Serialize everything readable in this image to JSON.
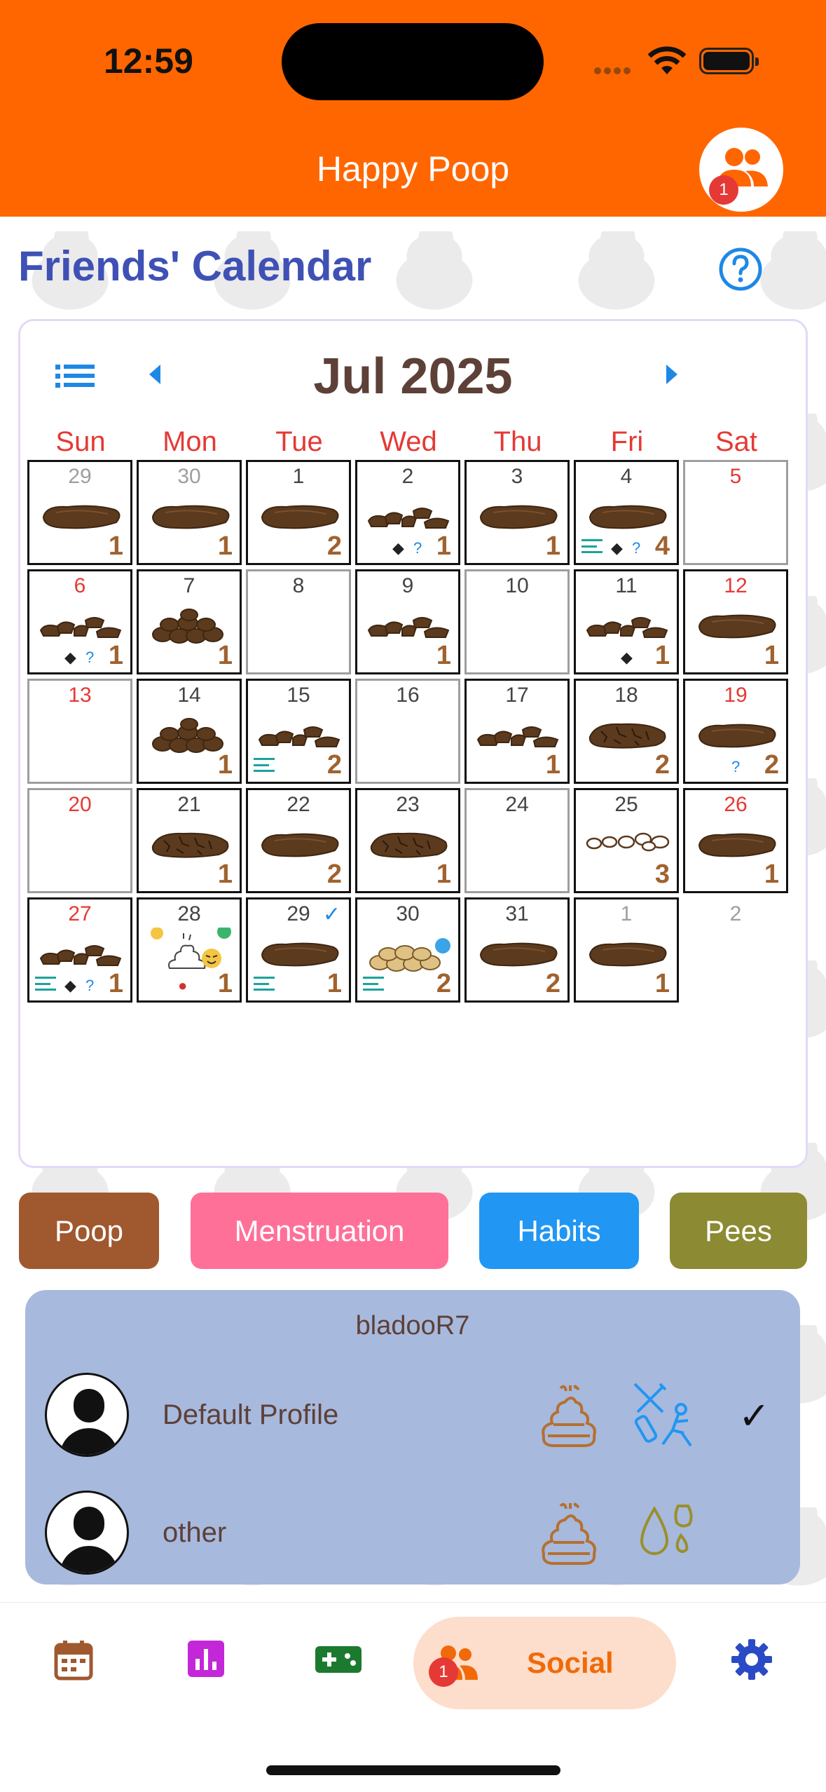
{
  "status_bar": {
    "time": "12:59"
  },
  "app": {
    "title": "Happy Poop",
    "friend_badge": "1"
  },
  "page": {
    "title": "Friends' Calendar"
  },
  "calendar": {
    "month_label": "Jul 2025",
    "weekdays": [
      "Sun",
      "Mon",
      "Tue",
      "Wed",
      "Thu",
      "Fri",
      "Sat"
    ],
    "weeks": [
      [
        {
          "d": "29",
          "c": "1",
          "p": "log",
          "other": true
        },
        {
          "d": "30",
          "c": "1",
          "p": "log",
          "other": true
        },
        {
          "d": "1",
          "c": "2",
          "p": "log"
        },
        {
          "d": "2",
          "c": "1",
          "p": "lumps",
          "skunk": true,
          "q": true
        },
        {
          "d": "3",
          "c": "1",
          "p": "log"
        },
        {
          "d": "4",
          "c": "4",
          "p": "log",
          "notes": true,
          "skunk": true,
          "q": true
        },
        {
          "d": "5",
          "c": "",
          "p": "",
          "weekend": true
        }
      ],
      [
        {
          "d": "6",
          "c": "1",
          "p": "lumps",
          "weekend": true,
          "skunk": true,
          "q": true
        },
        {
          "d": "7",
          "c": "1",
          "p": "pile"
        },
        {
          "d": "8",
          "c": "",
          "p": ""
        },
        {
          "d": "9",
          "c": "1",
          "p": "lumps"
        },
        {
          "d": "10",
          "c": "",
          "p": ""
        },
        {
          "d": "11",
          "c": "1",
          "p": "lumps",
          "skunk": true
        },
        {
          "d": "12",
          "c": "1",
          "p": "log",
          "weekend": true
        }
      ],
      [
        {
          "d": "13",
          "c": "",
          "p": "",
          "weekend": true
        },
        {
          "d": "14",
          "c": "1",
          "p": "pile"
        },
        {
          "d": "15",
          "c": "2",
          "p": "lumps",
          "notes": true
        },
        {
          "d": "16",
          "c": "",
          "p": ""
        },
        {
          "d": "17",
          "c": "1",
          "p": "lumps"
        },
        {
          "d": "18",
          "c": "2",
          "p": "cracked"
        },
        {
          "d": "19",
          "c": "2",
          "p": "log",
          "weekend": true,
          "q": true
        }
      ],
      [
        {
          "d": "20",
          "c": "",
          "p": "",
          "weekend": true
        },
        {
          "d": "21",
          "c": "1",
          "p": "cracked"
        },
        {
          "d": "22",
          "c": "2",
          "p": "log"
        },
        {
          "d": "23",
          "c": "1",
          "p": "cracked"
        },
        {
          "d": "24",
          "c": "",
          "p": ""
        },
        {
          "d": "25",
          "c": "3",
          "p": "pellets"
        },
        {
          "d": "26",
          "c": "1",
          "p": "log",
          "weekend": true
        }
      ],
      [
        {
          "d": "27",
          "c": "1",
          "p": "lumps",
          "weekend": true,
          "notes": true,
          "skunk": true,
          "q": true
        },
        {
          "d": "28",
          "c": "1",
          "p": "soft",
          "blood": true
        },
        {
          "d": "29",
          "c": "1",
          "p": "log",
          "notes": true,
          "check": true
        },
        {
          "d": "30",
          "c": "2",
          "p": "mushy",
          "notes": true
        },
        {
          "d": "31",
          "c": "2",
          "p": "log"
        },
        {
          "d": "1",
          "c": "1",
          "p": "log",
          "other": true
        },
        {
          "d": "2",
          "c": "",
          "p": "",
          "other": true,
          "noborder": true
        }
      ]
    ]
  },
  "filters": [
    {
      "label": "Poop",
      "color": "#A0582F"
    },
    {
      "label": "Menstruation",
      "color": "#FF7099"
    },
    {
      "label": "Habits",
      "color": "#2196F3"
    },
    {
      "label": "Pees",
      "color": "#8C8A33"
    }
  ],
  "friend": {
    "username": "bladooR7",
    "profiles": [
      {
        "name": "Default Profile",
        "icons": [
          "poop-icon",
          "habits-icon"
        ],
        "selected": true
      },
      {
        "name": "other",
        "icons": [
          "poop-icon",
          "pee-icon"
        ],
        "selected": false
      }
    ]
  },
  "nav": {
    "items": [
      "calendar-icon",
      "stats-icon",
      "game-icon",
      "social-icon",
      "settings-icon"
    ],
    "social_label": "Social",
    "social_badge": "1"
  },
  "colors": {
    "brand": "#FF6600",
    "title": "#3F51B5",
    "accent": "#1E88E5",
    "poop": "#5B3A1E"
  }
}
